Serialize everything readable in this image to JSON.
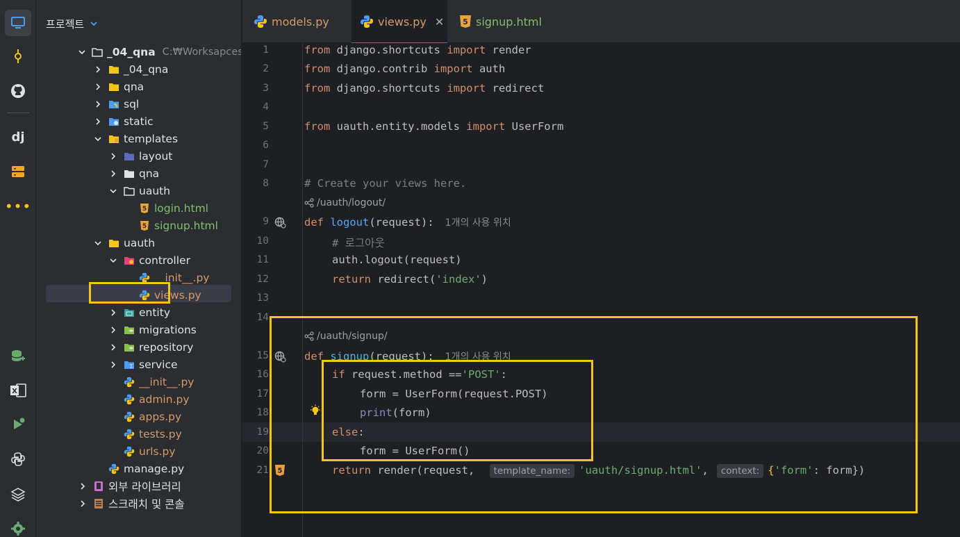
{
  "activity_bar": {
    "items": [
      "project-icon",
      "commit-icon",
      "github-icon",
      "django-icon",
      "structure-icon",
      "more-icon"
    ],
    "bottom_items": [
      "database-icon",
      "excel-icon",
      "run-icon",
      "python-icon",
      "layers-icon",
      "settings-icon"
    ]
  },
  "project": {
    "header": "프로젝트",
    "tree": [
      {
        "label": "_04_qna",
        "path": "C:₩Worksapces₩django",
        "type": "project-root"
      },
      {
        "label": "_04_qna",
        "type": "folder"
      },
      {
        "label": "qna",
        "type": "folder"
      },
      {
        "label": "sql",
        "type": "folder"
      },
      {
        "label": "static",
        "type": "folder"
      },
      {
        "label": "templates",
        "type": "folder"
      },
      {
        "label": "layout",
        "type": "folder"
      },
      {
        "label": "qna",
        "type": "folder"
      },
      {
        "label": "uauth",
        "type": "folder"
      },
      {
        "label": "login.html",
        "type": "html"
      },
      {
        "label": "signup.html",
        "type": "html"
      },
      {
        "label": "uauth",
        "type": "folder"
      },
      {
        "label": "controller",
        "type": "folder"
      },
      {
        "label": "__init__.py",
        "type": "py"
      },
      {
        "label": "views.py",
        "type": "py"
      },
      {
        "label": "entity",
        "type": "folder"
      },
      {
        "label": "migrations",
        "type": "folder"
      },
      {
        "label": "repository",
        "type": "folder"
      },
      {
        "label": "service",
        "type": "folder"
      },
      {
        "label": "__init__.py",
        "type": "py"
      },
      {
        "label": "admin.py",
        "type": "py"
      },
      {
        "label": "apps.py",
        "type": "py"
      },
      {
        "label": "tests.py",
        "type": "py"
      },
      {
        "label": "urls.py",
        "type": "py"
      },
      {
        "label": "manage.py",
        "type": "py"
      },
      {
        "label": "외부 라이브러리",
        "type": "library"
      },
      {
        "label": "스크래치 및 콘솔",
        "type": "scratch"
      }
    ]
  },
  "tabs": [
    {
      "label": "models.py",
      "icon": "python-icon",
      "active": false
    },
    {
      "label": "views.py",
      "icon": "python-icon",
      "active": true
    },
    {
      "label": "signup.html",
      "icon": "html-icon",
      "active": false
    }
  ],
  "editor": {
    "line_numbers": [
      "1",
      "2",
      "3",
      "4",
      "5",
      "6",
      "7",
      "8",
      "9",
      "10",
      "11",
      "12",
      "13",
      "14",
      "15",
      "16",
      "17",
      "18",
      "19",
      "20",
      "21"
    ],
    "route_logout": "/uauth/logout/",
    "route_signup": "/uauth/signup/",
    "usage_hint": "1개의 사용 위치",
    "inlay_template_name": "template_name:",
    "inlay_context": "context:",
    "lines": {
      "l1": [
        "from",
        " django.shortcuts ",
        "import",
        " render"
      ],
      "l2": [
        "from",
        " django.contrib ",
        "import",
        " auth"
      ],
      "l3": [
        "from",
        " django.shortcuts ",
        "import",
        " redirect"
      ],
      "l5": [
        "from",
        " uauth.entity.models ",
        "import",
        " UserForm"
      ],
      "l8": "# Create your views here.",
      "l9": [
        "def",
        " logout",
        "(request):"
      ],
      "l10": "# 로그아웃",
      "l11": "auth.logout(request)",
      "l12": [
        "return",
        " redirect(",
        "'index'",
        ")"
      ],
      "l15": [
        "def",
        " signup",
        "(request):"
      ],
      "l16": [
        "if",
        " request.method ==",
        "'POST'",
        ":"
      ],
      "l17": "form = UserForm(request.POST)",
      "l18": [
        "print",
        "(form)"
      ],
      "l19": [
        "else",
        ":"
      ],
      "l20": "form = UserForm()",
      "l21": [
        "return",
        " render(request, ",
        "'uauth/signup.html'",
        ",",
        "{",
        "'form'",
        ": form})"
      ]
    }
  },
  "colors": {
    "highlight_box": "#f5c518",
    "keyword": "#cf8e6d",
    "string": "#6aab73",
    "comment": "#7a7e85"
  }
}
